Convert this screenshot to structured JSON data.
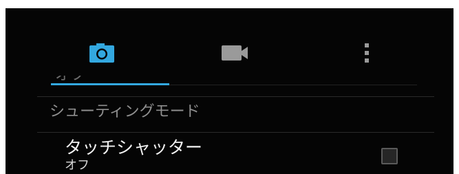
{
  "tabs": [
    {
      "icon": "camera-icon",
      "selected": true
    },
    {
      "icon": "video-icon",
      "selected": false
    },
    {
      "icon": "more-vert-icon",
      "selected": false
    }
  ],
  "accent_color": "#33a8e0",
  "scrolled_item_partial": "オフ",
  "section": {
    "header": "シューティングモード"
  },
  "setting": {
    "title": "タッチシャッター",
    "summary": "オフ",
    "checked": false
  }
}
